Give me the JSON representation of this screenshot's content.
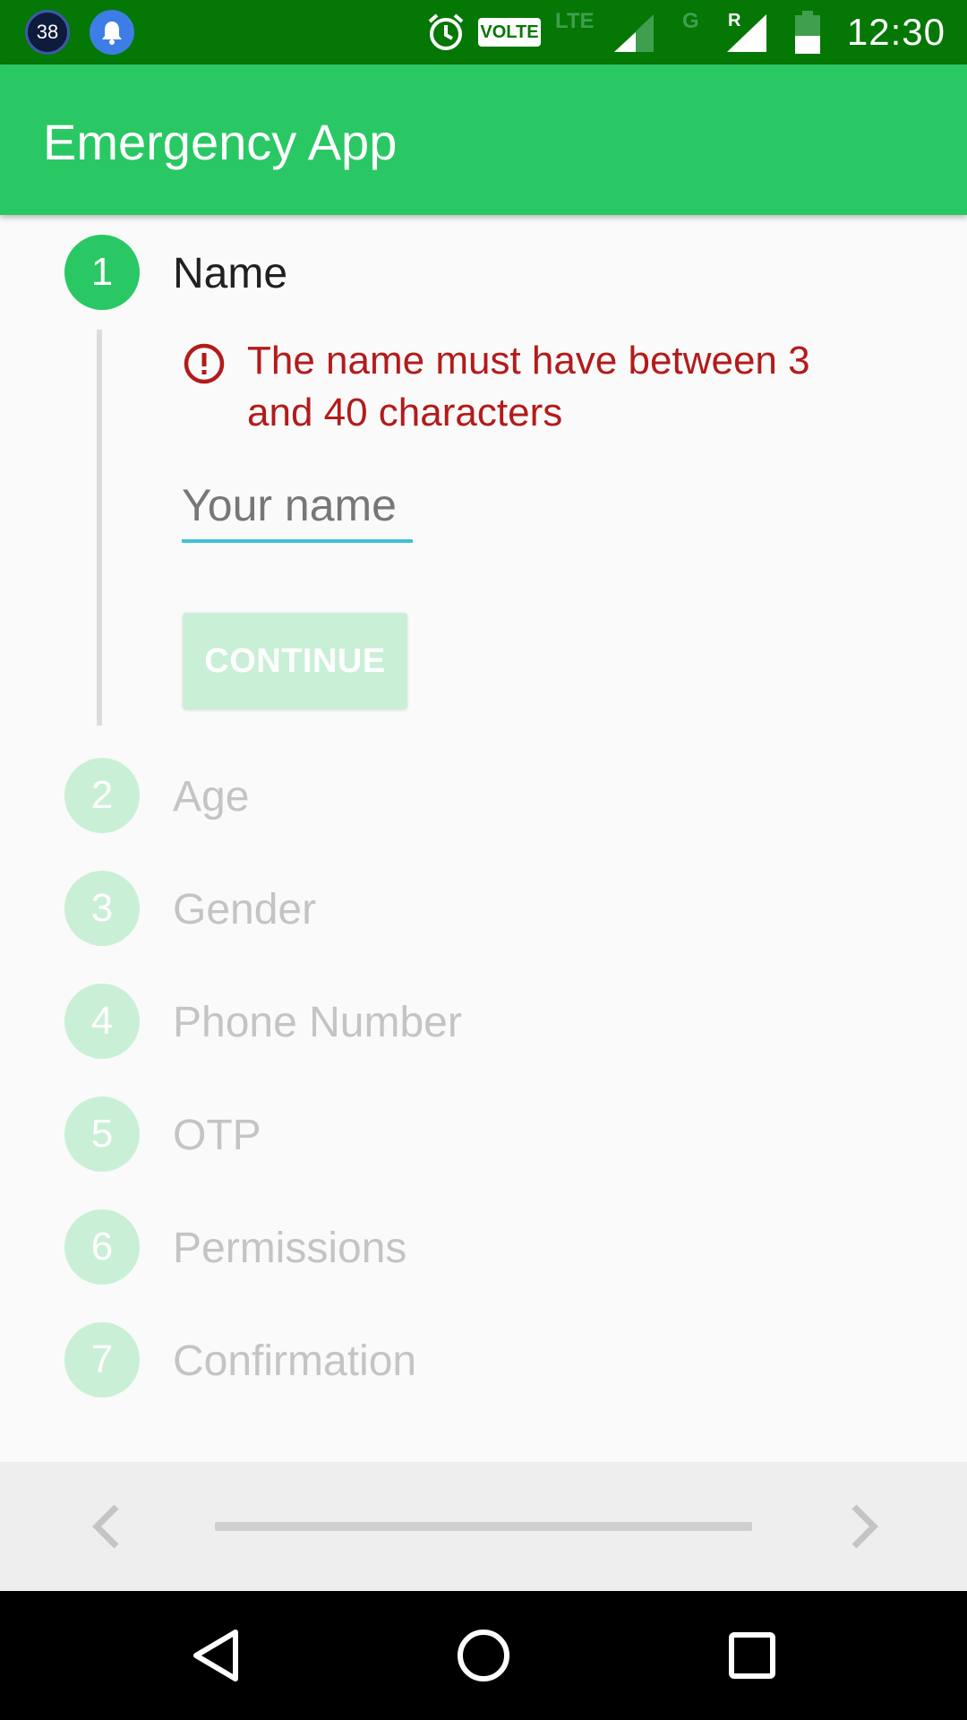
{
  "status_bar": {
    "notification_count": "38",
    "volte_label": "VOLTE",
    "lte_label": "LTE",
    "g_label": "G",
    "r_label": "R",
    "time": "12:30",
    "icons": [
      "notification-count-icon",
      "bell-icon",
      "alarm-icon",
      "volte-icon",
      "lte-icon",
      "signal-icon",
      "signal-roaming-icon",
      "battery-icon"
    ]
  },
  "app_bar": {
    "title": "Emergency App"
  },
  "stepper": {
    "active_step": {
      "number": "1",
      "title": "Name",
      "error_message": "The name must have between 3 and 40 characters",
      "input_placeholder": "Your name",
      "input_value": "",
      "continue_label": "CONTINUE"
    },
    "steps": [
      {
        "number": "2",
        "title": "Age"
      },
      {
        "number": "3",
        "title": "Gender"
      },
      {
        "number": "4",
        "title": "Phone Number"
      },
      {
        "number": "5",
        "title": "OTP"
      },
      {
        "number": "6",
        "title": "Permissions"
      },
      {
        "number": "7",
        "title": "Confirmation"
      }
    ]
  },
  "pager": {
    "prev_icon": "chevron-left-icon",
    "next_icon": "chevron-right-icon",
    "progress": 0
  },
  "nav_bar": {
    "icons": [
      "back-icon",
      "home-icon",
      "recents-icon"
    ]
  },
  "colors": {
    "status_bar": "#057705",
    "primary": "#2ac864",
    "primary_light": "#c9f0d6",
    "error": "#b31b1b",
    "input_underline": "#3ec2d8"
  }
}
